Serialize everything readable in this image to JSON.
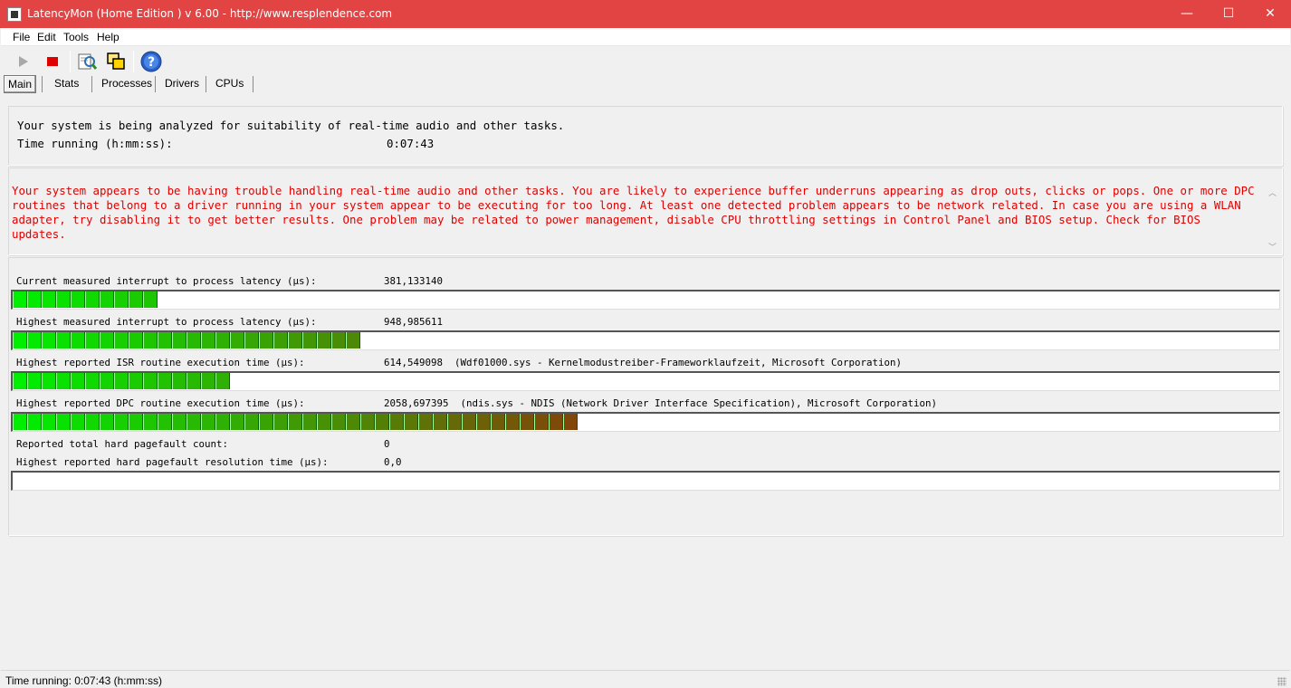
{
  "window": {
    "title": "LatencyMon  (Home Edition )  v 6.00 - http://www.resplendence.com",
    "min_glyph": "—",
    "max_glyph": "☐",
    "close_glyph": "✕"
  },
  "menu": [
    "File",
    "Edit",
    "Tools",
    "Help"
  ],
  "toolbar": {
    "icons": [
      "play-icon",
      "stop-icon",
      "report-icon",
      "windows-icon",
      "help-icon"
    ],
    "help_glyph": "?"
  },
  "tabs": [
    "Main",
    "Stats",
    "Processes",
    "Drivers",
    "CPUs"
  ],
  "summary": {
    "line1": "Your system is being analyzed for suitability of real-time audio and other tasks.",
    "time_label": "Time running (h:mm:ss):",
    "time_value": "0:07:43"
  },
  "warning": "Your system appears to be having trouble handling real-time audio and other tasks. You are likely to experience buffer underruns appearing as drop outs, clicks or pops. One or more DPC routines that belong to a driver running in your system appear to be executing for too long. At least one detected problem appears to be network related. In case you are using a WLAN adapter, try disabling it to get better results. One problem may be related to power management, disable CPU throttling settings in Control Panel and BIOS setup. Check for BIOS updates.",
  "stats": [
    {
      "label": "Current measured interrupt to process latency (µs):",
      "value": "381,133140",
      "segments": 10
    },
    {
      "label": "Highest measured interrupt to process latency (µs):",
      "value": "948,985611",
      "segments": 24
    },
    {
      "label": "Highest reported ISR routine execution time (µs):",
      "value": "614,549098  (Wdf01000.sys - Kernelmodustreiber-Frameworklaufzeit, Microsoft Corporation)",
      "segments": 15
    },
    {
      "label": "Highest reported DPC routine execution time (µs):",
      "value": "2058,697395  (ndis.sys - NDIS (Network Driver Interface Specification), Microsoft Corporation)",
      "segments": 39
    },
    {
      "label": "Reported total hard pagefault count:",
      "value": "0"
    },
    {
      "label": "Highest reported hard pagefault resolution time (µs):",
      "value": "0,0",
      "segments": 0
    }
  ],
  "status": "Time running: 0:07:43  (h:mm:ss)"
}
